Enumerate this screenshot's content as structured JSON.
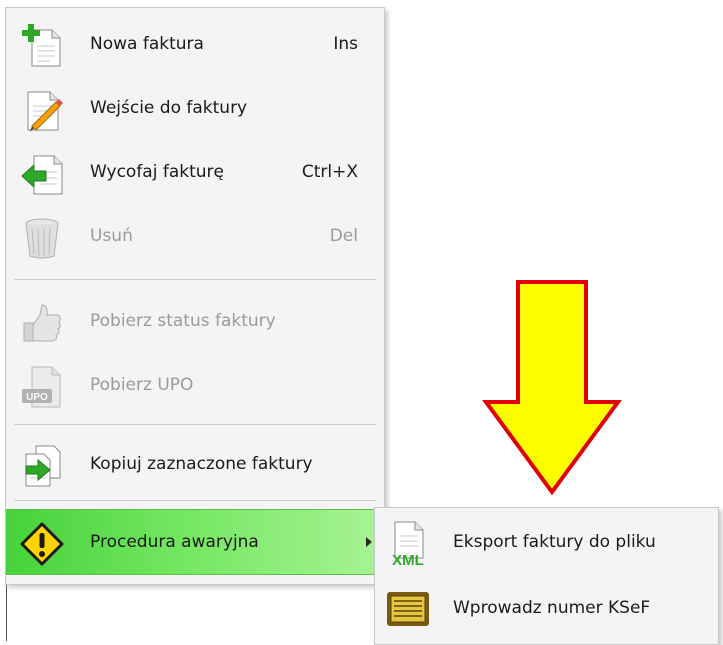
{
  "menu": {
    "items": [
      {
        "label": "Nowa faktura",
        "shortcut": "Ins"
      },
      {
        "label": "Wejście do faktury",
        "shortcut": ""
      },
      {
        "label": "Wycofaj fakturę",
        "shortcut": "Ctrl+X"
      },
      {
        "label": "Usuń",
        "shortcut": "Del"
      },
      {
        "label": "Pobierz status faktury",
        "shortcut": ""
      },
      {
        "label": "Pobierz UPO",
        "shortcut": ""
      },
      {
        "label": "Kopiuj zaznaczone faktury",
        "shortcut": ""
      },
      {
        "label": "Procedura awaryjna",
        "shortcut": ""
      }
    ]
  },
  "submenu": {
    "items": [
      {
        "label": "Eksport faktury do pliku"
      },
      {
        "label": "Wprowadz numer KSeF"
      }
    ]
  },
  "icons": {
    "upo_text": "UPO",
    "xml_text": "XML"
  },
  "colors": {
    "highlight": "#5edc4a",
    "annotation_arrow_fill": "#ffff00",
    "annotation_arrow_stroke": "#e00000"
  }
}
